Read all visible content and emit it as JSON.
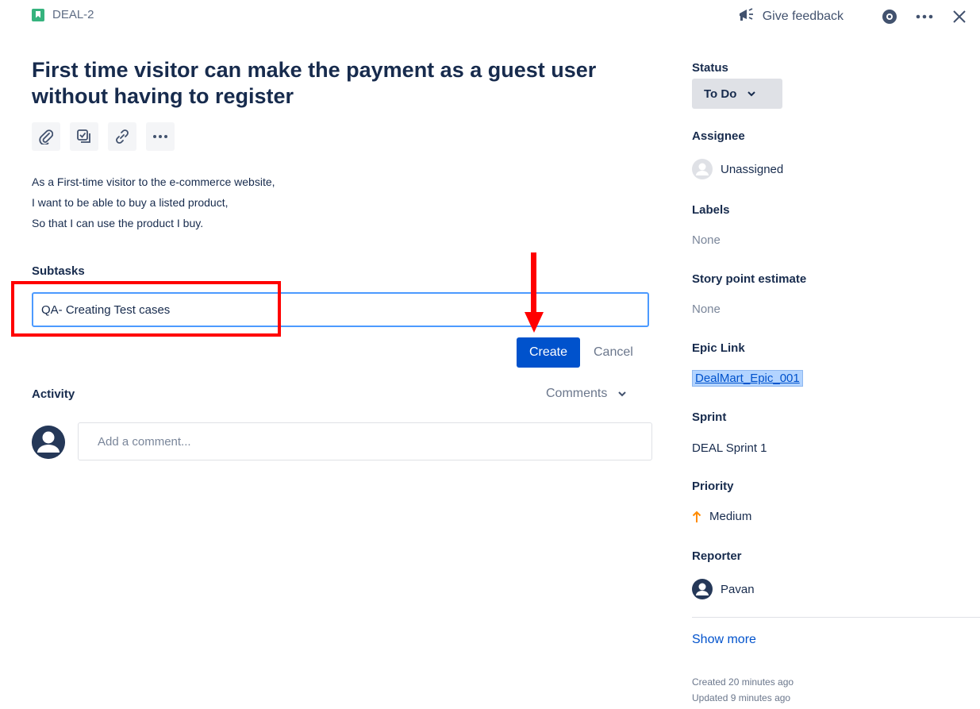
{
  "header": {
    "issue_key": "DEAL-2",
    "give_feedback": "Give feedback",
    "icons": [
      "story-icon",
      "megaphone-icon",
      "eye-icon",
      "more-icon",
      "close-icon"
    ]
  },
  "issue": {
    "title_line1": "First time visitor can make the payment as a guest user",
    "title_line2": "without having to register",
    "toolbar_icons": [
      "attachment-icon",
      "checklist-icon",
      "link-icon",
      "more-icon"
    ],
    "description": [
      "As a First-time visitor to the e-commerce website,",
      "I want to be able to buy a listed product,",
      "So that I can use the product I buy."
    ]
  },
  "subtasks": {
    "label": "Subtasks",
    "input_value": "QA- Creating Test cases",
    "create_label": "Create",
    "cancel_label": "Cancel"
  },
  "activity": {
    "label": "Activity",
    "filter_label": "Comments",
    "comment_placeholder": "Add a comment..."
  },
  "details": {
    "status_label": "Status",
    "status_value": "To Do",
    "assignee_label": "Assignee",
    "assignee_value": "Unassigned",
    "labels_label": "Labels",
    "labels_value": "None",
    "story_points_label": "Story point estimate",
    "story_points_value": "None",
    "epic_label": "Epic Link",
    "epic_value": "DealMart_Epic_001",
    "sprint_label": "Sprint",
    "sprint_value": "DEAL Sprint 1",
    "priority_label": "Priority",
    "priority_value": "Medium",
    "reporter_label": "Reporter",
    "reporter_value": "Pavan",
    "show_more": "Show more",
    "created": "Created 20 minutes ago",
    "updated": "Updated 9 minutes ago"
  },
  "colors": {
    "accent": "#0052cc",
    "annotation_red": "#ff0000",
    "story_green": "#36b37e",
    "priority_orange": "#ff8b00"
  }
}
